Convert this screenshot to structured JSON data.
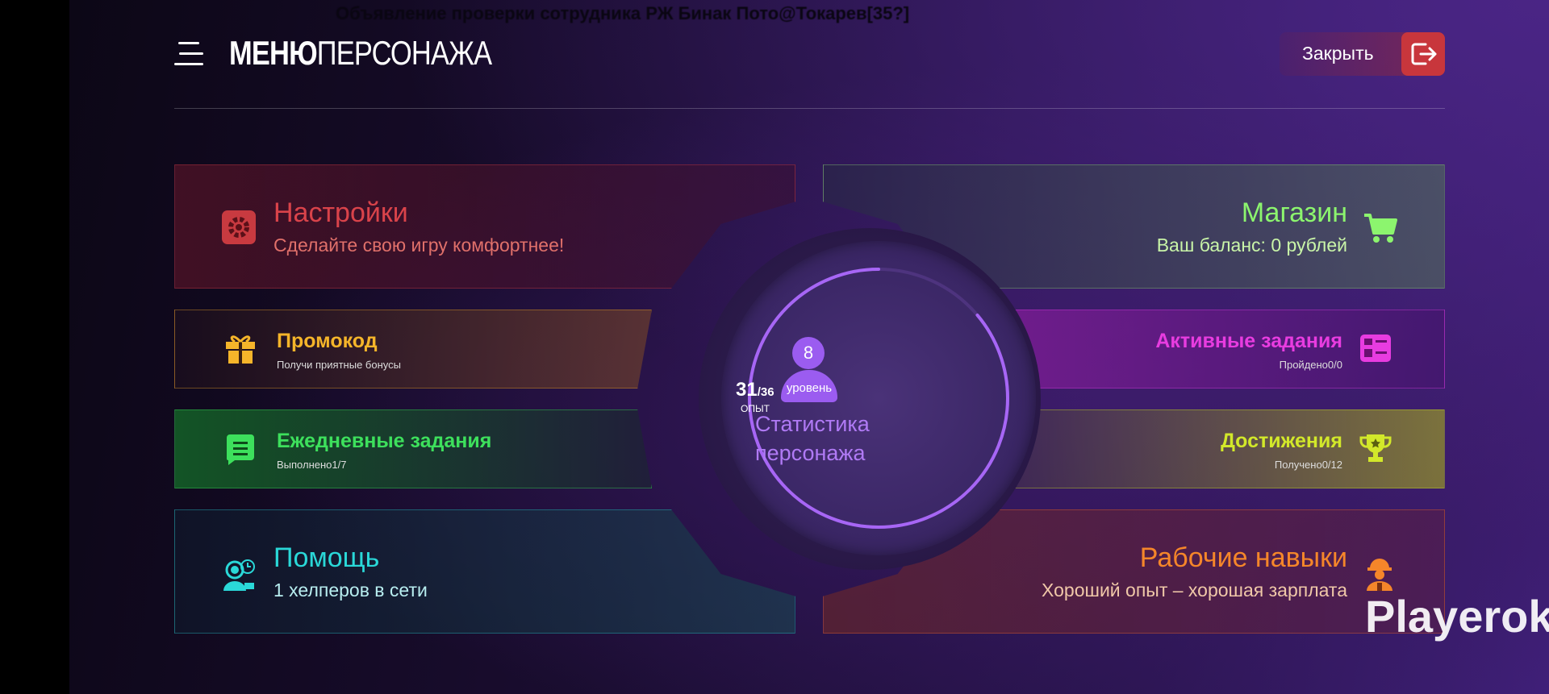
{
  "header": {
    "top_text": "Объявление проверки сотрудника РЖ Бинак Пото@Токарев[35?]",
    "title_bold": "МЕНЮ",
    "title_rest": "ПЕРСОНАЖА",
    "close_label": "Закрыть"
  },
  "cards": {
    "settings": {
      "title": "Настройки",
      "subtitle": "Сделайте свою игру комфортнее!",
      "color": "#d9434a"
    },
    "shop": {
      "title": "Магазин",
      "subtitle": "Ваш баланс: 0 рублей",
      "color": "#8cf56e"
    },
    "promo": {
      "title": "Промокод",
      "subtitle": "Получи приятные бонусы",
      "color": "#f5b52a"
    },
    "active": {
      "title": "Активные задания",
      "subtitle": "Пройдено0/0",
      "color": "#e83ce0"
    },
    "daily": {
      "title": "Ежедневные задания",
      "subtitle": "Выполнено1/7",
      "color": "#3de05c"
    },
    "achievements": {
      "title": "Достижения",
      "subtitle": "Получено0/12",
      "color": "#d2e82a"
    },
    "help": {
      "title": "Помощь",
      "subtitle": "1 хелперов в сети",
      "color": "#2ad8d8"
    },
    "skills": {
      "title": "Рабочие навыки",
      "subtitle": "Хороший опыт – хорошая зарплата",
      "color": "#f5862a"
    }
  },
  "stats": {
    "level": "8",
    "level_label": "уровень",
    "label_line1": "Статистика",
    "label_line2": "персонажа",
    "xp_current": "31",
    "xp_max": "/36",
    "xp_label": "ОПЫТ",
    "xp_fraction": 0.861
  },
  "watermark": "Playerok"
}
